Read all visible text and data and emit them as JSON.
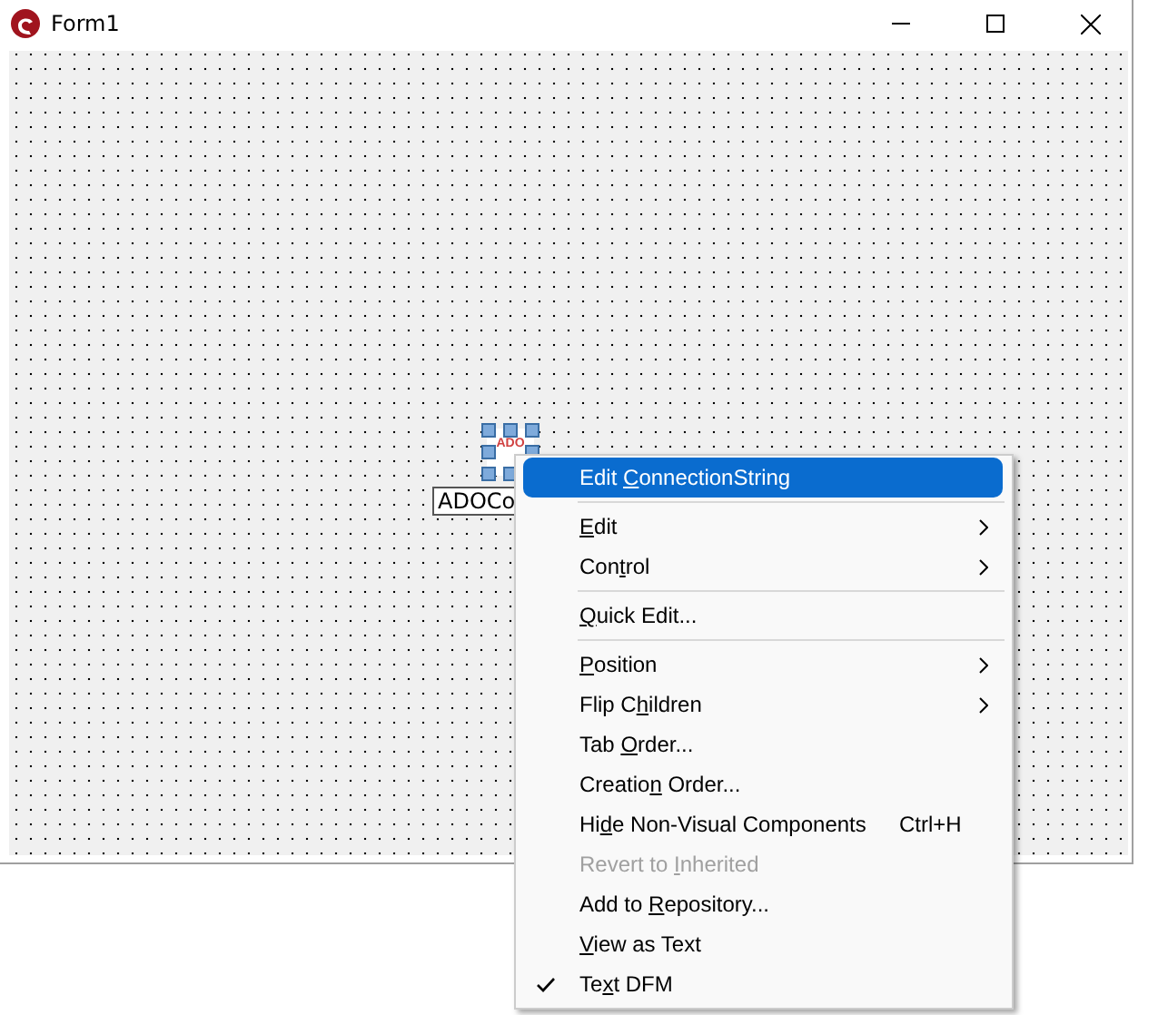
{
  "window": {
    "title": "Form1"
  },
  "component": {
    "icon_text": "ADO",
    "caption": "ADOCo",
    "selected": true
  },
  "menu": [
    {
      "kind": "item",
      "label_start": "Edit ",
      "accel": "C",
      "label_end": "onnectionString",
      "selected": true,
      "disabled": false,
      "checked": false,
      "submenu": false
    },
    {
      "kind": "separator"
    },
    {
      "kind": "item",
      "accel": "E",
      "label_end": "dit",
      "selected": false,
      "disabled": false,
      "checked": false,
      "submenu": true
    },
    {
      "kind": "item",
      "label_start": "Con",
      "accel": "t",
      "label_end": "rol",
      "selected": false,
      "disabled": false,
      "checked": false,
      "submenu": true
    },
    {
      "kind": "separator"
    },
    {
      "kind": "item",
      "accel": "Q",
      "label_end": "uick Edit...",
      "selected": false,
      "disabled": false,
      "checked": false,
      "submenu": false
    },
    {
      "kind": "separator"
    },
    {
      "kind": "item",
      "accel": "P",
      "label_end": "osition",
      "selected": false,
      "disabled": false,
      "checked": false,
      "submenu": true
    },
    {
      "kind": "item",
      "label_start": "Flip C",
      "accel": "h",
      "label_end": "ildren",
      "selected": false,
      "disabled": false,
      "checked": false,
      "submenu": true
    },
    {
      "kind": "item",
      "label_start": "Tab ",
      "accel": "O",
      "label_end": "rder...",
      "selected": false,
      "disabled": false,
      "checked": false,
      "submenu": false
    },
    {
      "kind": "item",
      "label_start": "Creatio",
      "accel": "n",
      "label_end": " Order...",
      "selected": false,
      "disabled": false,
      "checked": false,
      "submenu": false
    },
    {
      "kind": "item",
      "label_start": "Hi",
      "accel": "d",
      "label_end": "e Non-Visual Components",
      "shortcut": "Ctrl+H",
      "selected": false,
      "disabled": false,
      "checked": false,
      "submenu": false
    },
    {
      "kind": "item",
      "label_start": "Revert to ",
      "accel": "I",
      "label_end": "nherited",
      "selected": false,
      "disabled": true,
      "checked": false,
      "submenu": false
    },
    {
      "kind": "item",
      "label_start": "Add to ",
      "accel": "R",
      "label_end": "epository...",
      "selected": false,
      "disabled": false,
      "checked": false,
      "submenu": false
    },
    {
      "kind": "item",
      "accel": "V",
      "label_end": "iew as Text",
      "selected": false,
      "disabled": false,
      "checked": false,
      "submenu": false
    },
    {
      "kind": "item",
      "label_start": "Te",
      "accel": "x",
      "label_end": "t DFM",
      "selected": false,
      "disabled": false,
      "checked": true,
      "submenu": false
    }
  ]
}
